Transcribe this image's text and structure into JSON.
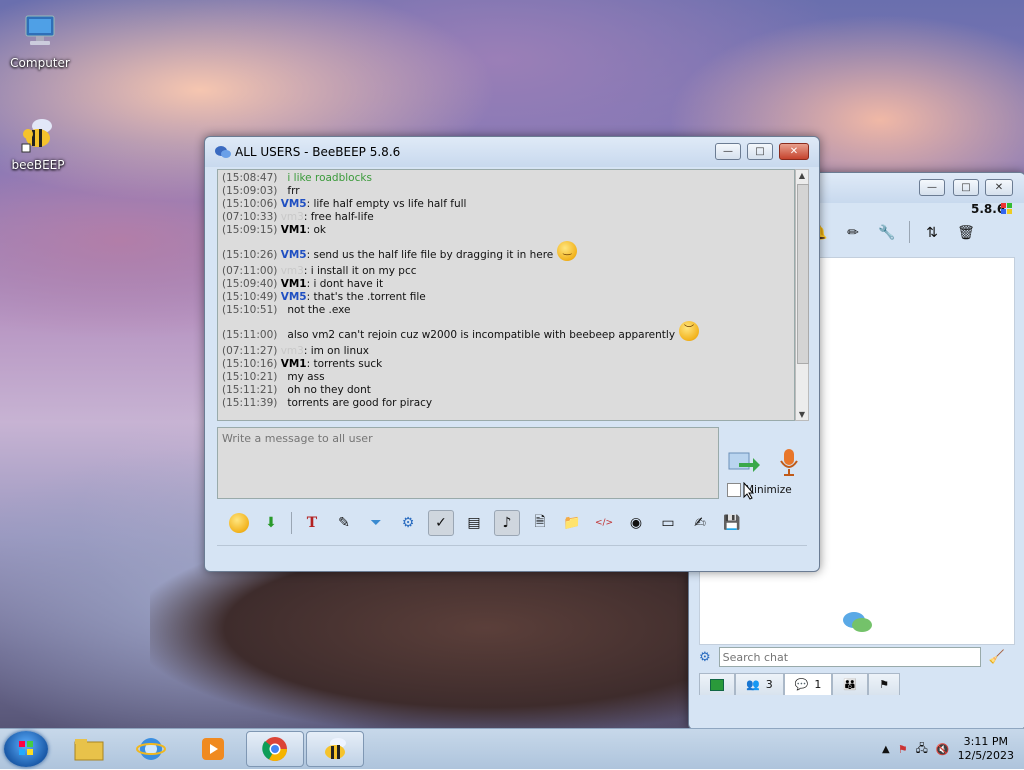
{
  "desktop": {
    "icons": [
      {
        "label": "Computer",
        "icon": "computer-icon"
      },
      {
        "label": "beeBEEP",
        "icon": "bee-icon"
      }
    ]
  },
  "chat_window": {
    "title": "ALL USERS - BeeBEEP 5.8.6",
    "controls": {
      "minimize": "—",
      "maximize": "□",
      "close": "✕"
    },
    "messages": [
      {
        "time": "(15:08:47)",
        "user": "",
        "text": "i like roadblocks",
        "style": "green"
      },
      {
        "time": "(15:09:03)",
        "user": "",
        "text": "frr",
        "style": "plain"
      },
      {
        "time": "(15:10:06)",
        "user": "VM5",
        "text": ": life half empty vs life half full",
        "style": "vm5"
      },
      {
        "time": "(07:10:33)",
        "user": "vm3",
        "text": ": free half-life",
        "style": "faded"
      },
      {
        "time": "(15:09:15)",
        "user": "VM1",
        "text": ": ok",
        "style": "vm1"
      },
      {
        "time": "(15:10:26)",
        "user": "VM5",
        "text": ": send us the half life file by dragging it in here",
        "style": "vm5",
        "emoji": "tongue-emoji"
      },
      {
        "time": "(07:11:00)",
        "user": "vm3",
        "text": ": i install it on my pcc",
        "style": "faded"
      },
      {
        "time": "(15:09:40)",
        "user": "VM1",
        "text": ": i dont have it",
        "style": "vm1"
      },
      {
        "time": "(15:10:49)",
        "user": "VM5",
        "text": ": that's the .torrent file",
        "style": "vm5"
      },
      {
        "time": "(15:10:51)",
        "user": "",
        "text": "not the .exe",
        "style": "plain"
      },
      {
        "time": "(15:11:00)",
        "user": "",
        "text": "also vm2 can't rejoin cuz w2000 is incompatible with beebeep apparently",
        "style": "plain",
        "emoji": "sad-emoji"
      },
      {
        "time": "(07:11:27)",
        "user": "vm3",
        "text": ": im on linux",
        "style": "faded"
      },
      {
        "time": "(15:10:16)",
        "user": "VM1",
        "text": ": torrents suck",
        "style": "vm1"
      },
      {
        "time": "(15:10:21)",
        "user": "",
        "text": "my ass",
        "style": "plain"
      },
      {
        "time": "(15:11:21)",
        "user": "",
        "text": "oh no they dont",
        "style": "plain"
      },
      {
        "time": "(15:11:39)",
        "user": "",
        "text": "torrents are good for piracy",
        "style": "plain"
      }
    ],
    "compose_placeholder": "Write a message to all user",
    "minimize_label": "Minimize",
    "toolbar_icons": [
      "smiley-icon",
      "download-icon",
      "text-format-icon",
      "color-picker-icon",
      "filter-icon",
      "settings-gear-icon",
      "spellcheck-icon",
      "dictionary-icon",
      "music-note-icon",
      "save-chat-icon",
      "send-folder-icon",
      "html-code-icon",
      "screenshot-icon",
      "window-icon",
      "edit-note-icon",
      "save-disk-icon"
    ]
  },
  "main_window": {
    "version": "5.8.6",
    "controls": {
      "minimize": "—",
      "maximize": "□",
      "close": "✕"
    },
    "search_placeholder": "Search chat",
    "tabs": [
      {
        "icon": "green-screen-icon",
        "count": ""
      },
      {
        "icon": "users-icon",
        "count": "3"
      },
      {
        "icon": "chat-bubbles-icon",
        "count": "1"
      },
      {
        "icon": "groups-icon",
        "count": ""
      },
      {
        "icon": "flag-icon",
        "count": ""
      }
    ]
  },
  "taskbar": {
    "apps": [
      "windows-explorer-icon",
      "internet-explorer-icon",
      "media-player-icon",
      "chrome-icon",
      "beebeep-icon"
    ],
    "clock_time": "3:11 PM",
    "clock_date": "12/5/2023"
  }
}
